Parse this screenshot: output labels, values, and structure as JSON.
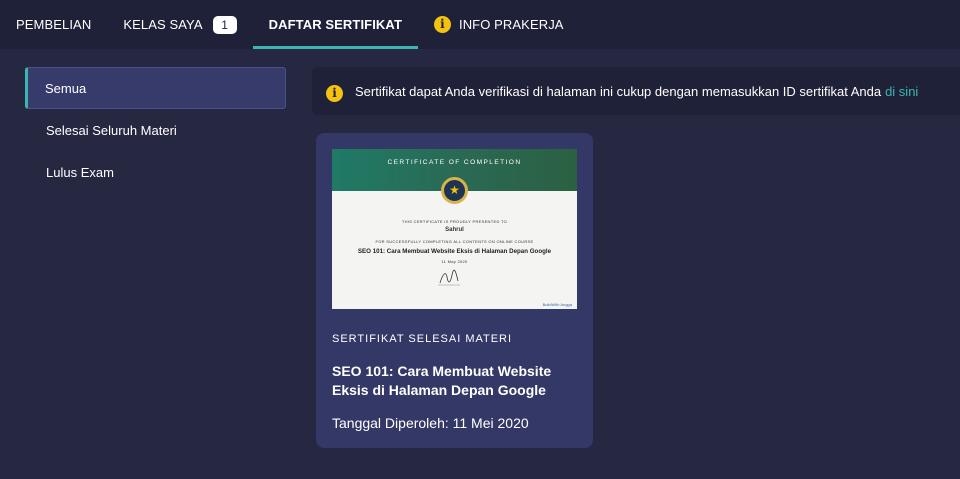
{
  "tabs": [
    {
      "label": "PEMBELIAN"
    },
    {
      "label": "KELAS SAYA",
      "badge": "1"
    },
    {
      "label": "DAFTAR SERTIFIKAT",
      "active": true
    },
    {
      "label": "INFO PRAKERJA",
      "icon": "info-icon"
    }
  ],
  "sidebar": {
    "items": [
      {
        "label": "Semua",
        "active": true
      },
      {
        "label": "Selesai Seluruh Materi"
      },
      {
        "label": "Lulus Exam"
      }
    ]
  },
  "notice": {
    "icon": "info-icon",
    "text": "Sertifikat dapat Anda verifikasi di halaman ini cukup dengan memasukkan ID sertifikat Anda",
    "link": "di sini"
  },
  "certificate_card": {
    "image": {
      "heading": "CERTIFICATE OF COMPLETION",
      "presented": "THIS CERTIFICATE IS PROUDLY PRESENTED TO",
      "name": "Sahrul",
      "for_text": "FOR SUCCESSFULLY COMPLETING ALL CONTENTS ON ONLINE COURSE",
      "course": "SEO 101: Cara Membuat Website Eksis di Halaman Depan Google",
      "date": "11 May 2020",
      "logo": "BuildWith Angga"
    },
    "type": "SERTIFIKAT SELESAI MATERI",
    "title": "SEO 101: Cara Membuat Website Eksis di Halaman Depan Google",
    "date": "Tanggal Diperoleh: 11 Mei 2020"
  },
  "colors": {
    "background": "#262842",
    "nav": "#1f2138",
    "accent": "#3ab5b0",
    "card": "#343867",
    "info": "#f5c20f"
  }
}
